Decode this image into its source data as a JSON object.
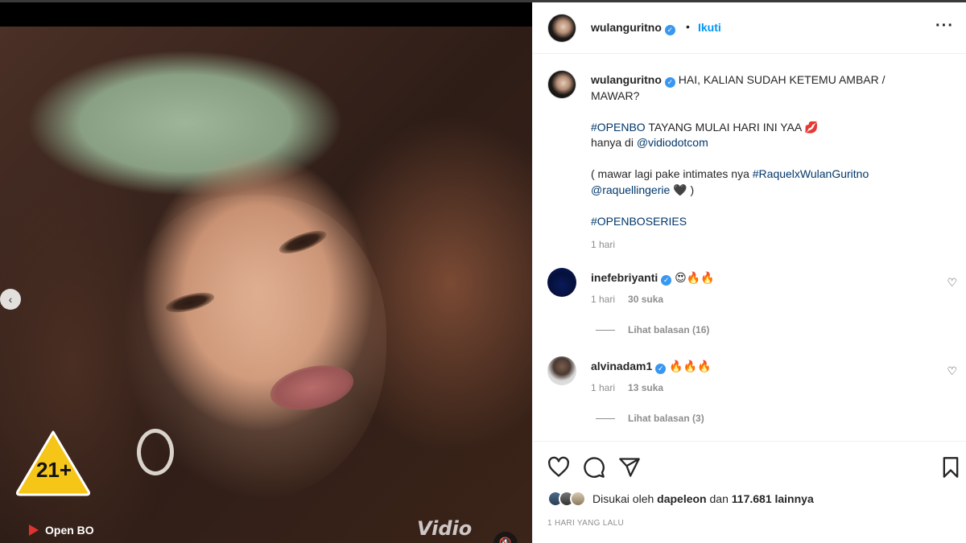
{
  "media": {
    "rating_label": "21+",
    "show_title": "Open BO",
    "watermark": "Vidio",
    "prev_icon": "chevron-left-icon",
    "mute_icon": "muted-speaker-icon"
  },
  "post": {
    "username": "wulanguritno",
    "separator": "•",
    "follow_label": "Ikuti",
    "more_icon": "more-options-icon"
  },
  "caption": {
    "username": "wulanguritno",
    "line1": "HAI, KALIAN SUDAH KETEMU AMBAR /",
    "line2": "MAWAR?",
    "p2_tag": "#OPENBO",
    "p2_text": " TAYANG MULAI HARI INI YAA 💋",
    "p3_text": "hanya di ",
    "p3_mention": "@vidiodotcom",
    "p4_text": "( mawar lagi pake intimates nya ",
    "p4_tag": "#RaquelxWulanGuritno",
    "p4_mention": "@raquellingerie",
    "p4_end": " 🖤 )",
    "p5_tag": "#OPENBOSERIES",
    "time": "1 hari"
  },
  "comments": [
    {
      "username": "inefebriyanti",
      "text": "😍🔥🔥",
      "time": "1 hari",
      "likes": "30 suka",
      "replies": "Lihat balasan (16)"
    },
    {
      "username": "alvinadam1",
      "text": "🔥🔥🔥",
      "time": "1 hari",
      "likes": "13 suka",
      "replies": "Lihat balasan (3)"
    }
  ],
  "actions": {
    "like_icon": "heart-icon",
    "comment_icon": "comment-icon",
    "share_icon": "send-icon",
    "save_icon": "bookmark-icon"
  },
  "likes": {
    "prefix": "Disukai oleh ",
    "user": "dapeleon",
    "middle": " dan ",
    "count": "117.681 lainnya"
  },
  "timeago": "1 HARI YANG LALU",
  "colors": {
    "link": "#00376b",
    "follow": "#0095f6",
    "verified": "#3897f0",
    "rating_badge": "#f5c518"
  }
}
